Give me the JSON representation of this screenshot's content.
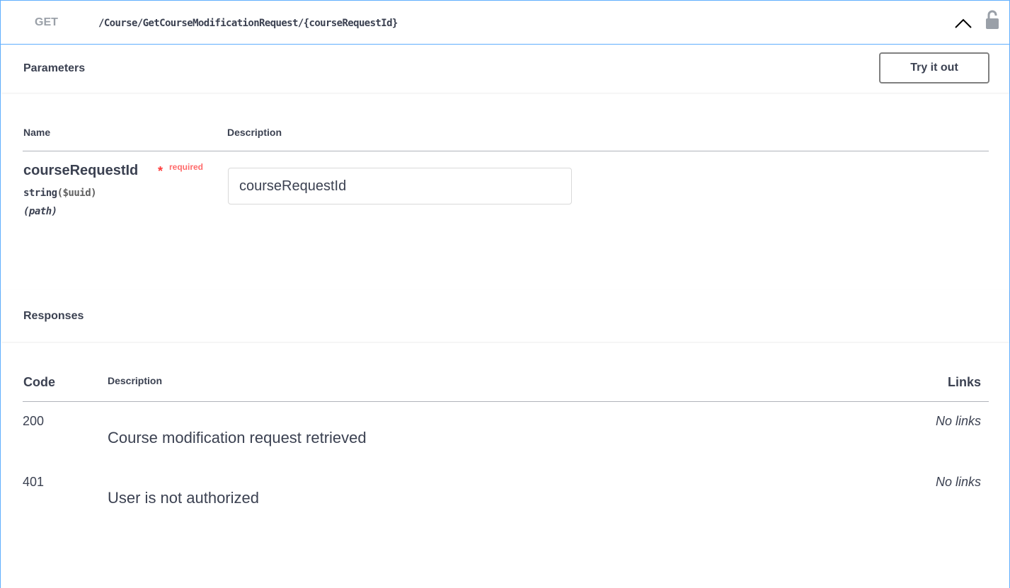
{
  "operation": {
    "method": "GET",
    "path": "/Course/GetCourseModificationRequest/{courseRequestId}"
  },
  "parameters": {
    "title": "Parameters",
    "try_it_out_label": "Try it out",
    "columns": {
      "name": "Name",
      "description": "Description"
    },
    "items": [
      {
        "name": "courseRequestId",
        "required_star": "*",
        "required_label": "required",
        "type": "string",
        "format": "($uuid)",
        "in": "(path)",
        "placeholder": "courseRequestId"
      }
    ]
  },
  "responses": {
    "title": "Responses",
    "columns": {
      "code": "Code",
      "description": "Description",
      "links": "Links"
    },
    "items": [
      {
        "code": "200",
        "description": "Course modification request retrieved",
        "links": "No links"
      },
      {
        "code": "401",
        "description": "User is not authorized",
        "links": "No links"
      }
    ]
  },
  "colors": {
    "accent_border": "#61affe",
    "required": "#ff3b3b",
    "text": "#3b4151"
  },
  "icons": {
    "collapse": "chevron-up-icon",
    "auth": "unlocked-padlock-icon"
  }
}
